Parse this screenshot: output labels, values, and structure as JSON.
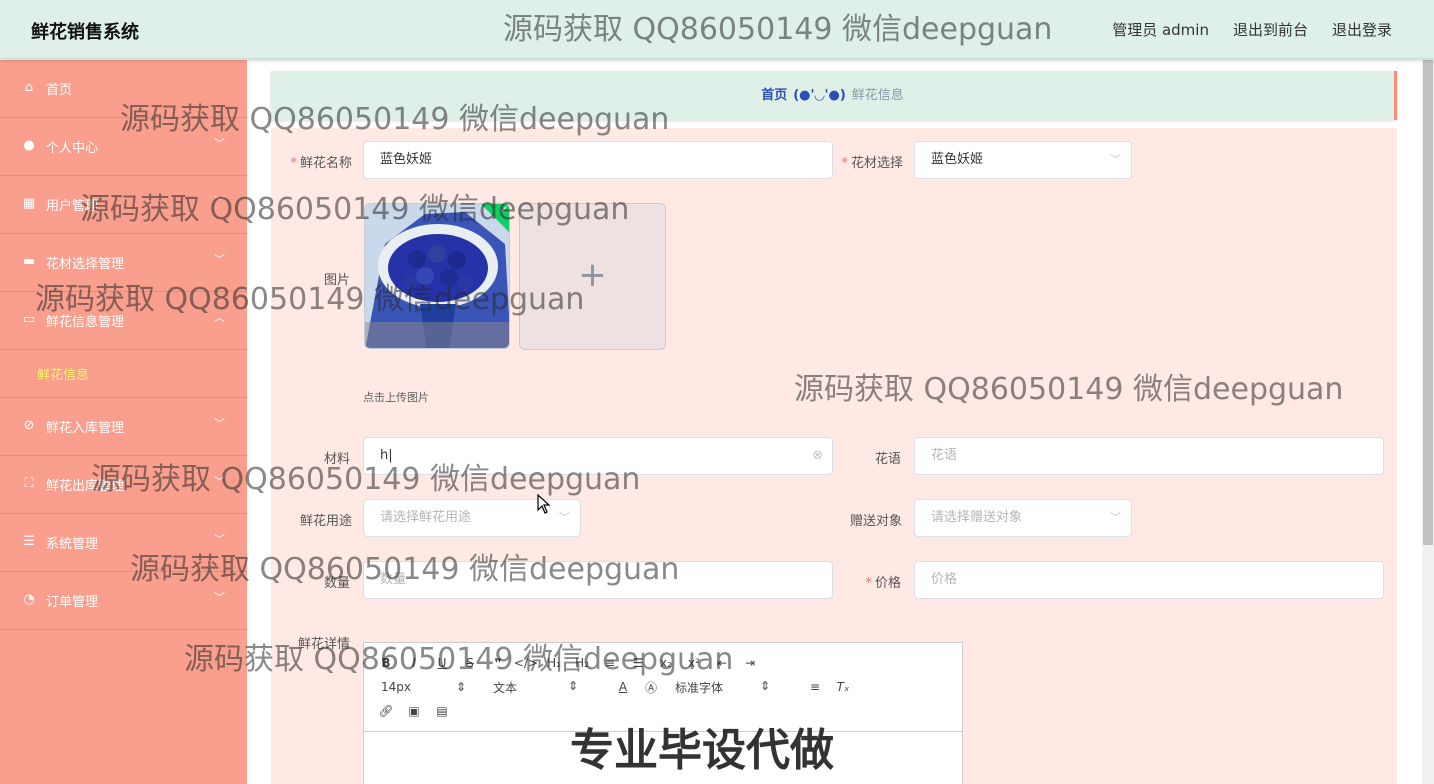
{
  "header": {
    "brand": "鲜花销售系统",
    "user": "管理员 admin",
    "to_front": "退出到前台",
    "logout": "退出登录"
  },
  "sidebar": {
    "items": [
      {
        "label": "首页",
        "icon": "home-icon"
      },
      {
        "label": "个人中心",
        "icon": "user-icon"
      },
      {
        "label": "用户管理",
        "icon": "grid-icon"
      },
      {
        "label": "花材选择管理",
        "icon": "box-icon"
      },
      {
        "label": "鲜花信息管理",
        "icon": "chat-icon"
      },
      {
        "label": "鲜花入库管理",
        "icon": "bell-off-icon"
      },
      {
        "label": "鲜花出库管理",
        "icon": "frame-icon"
      },
      {
        "label": "系统管理",
        "icon": "sliders-icon"
      },
      {
        "label": "订单管理",
        "icon": "gauge-icon"
      }
    ],
    "active_sub": "鲜花信息"
  },
  "breadcrumb": {
    "home": "首页",
    "separator": "(●'◡'●)",
    "current": "鲜花信息"
  },
  "form": {
    "name_label": "鲜花名称",
    "name_value": "蓝色妖姬",
    "material_select_label": "花材选择",
    "material_select_value": "蓝色妖姬",
    "image_label": "图片",
    "upload_hint": "点击上传图片",
    "material_label": "材料",
    "material_value": "h",
    "flower_lang_label": "花语",
    "flower_lang_placeholder": "花语",
    "usage_label": "鲜花用途",
    "usage_placeholder": "请选择鲜花用途",
    "gift_label": "赠送对象",
    "gift_placeholder": "请选择赠送对象",
    "qty_label": "数量",
    "qty_placeholder": "数量",
    "price_label": "价格",
    "price_placeholder": "价格",
    "detail_label": "鲜花详情"
  },
  "editor": {
    "font_size": "14px",
    "block_type": "文本",
    "font_family": "标准字体"
  },
  "watermarks": {
    "text": "源码获取 QQ86050149 微信deepguan",
    "big": "专业毕设代做"
  }
}
